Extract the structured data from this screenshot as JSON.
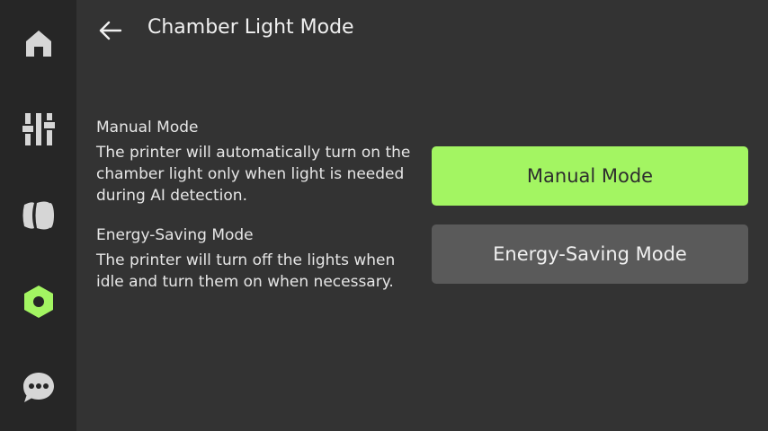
{
  "nav": {
    "items": [
      {
        "icon": "home-icon"
      },
      {
        "icon": "sliders-icon"
      },
      {
        "icon": "filament-icon"
      },
      {
        "icon": "settings-nut-icon",
        "active": true
      },
      {
        "icon": "chat-bubble-icon"
      }
    ],
    "active_color": "#a3f562",
    "inactive_color": "#d6d6d6"
  },
  "header": {
    "title": "Chamber Light Mode",
    "back_icon": "arrow-left-icon"
  },
  "descriptions": {
    "manual": {
      "title": "Manual Mode",
      "text": "The printer will automatically turn on the chamber light only when light is needed during AI detection."
    },
    "energy": {
      "title": "Energy-Saving Mode",
      "text": "The printer will turn off the lights when idle and turn them on when necessary."
    }
  },
  "buttons": {
    "manual_label": "Manual Mode",
    "energy_label": "Energy-Saving Mode",
    "selected": "manual"
  },
  "colors": {
    "accent": "#a3f562",
    "background": "#333333",
    "sidebar": "#262626",
    "inactive_button": "#5a5a5a"
  }
}
